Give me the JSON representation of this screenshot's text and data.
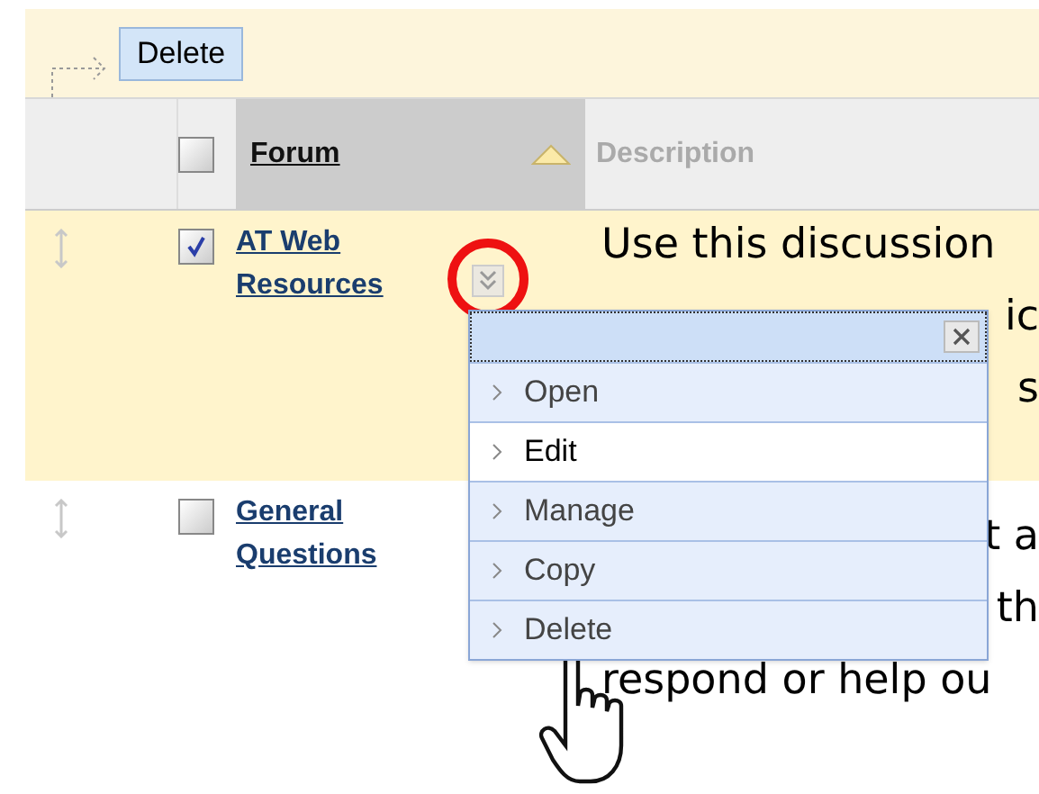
{
  "action_bar": {
    "button": "Delete"
  },
  "table": {
    "select_all": {
      "checked": false
    },
    "columns": [
      {
        "label": "Forum",
        "sorted": true
      },
      {
        "label": "Description",
        "sorted": false
      }
    ],
    "rows": [
      {
        "selected": true,
        "checked": true,
        "title": "AT Web Resources",
        "description_lines": [
          {
            "text": "Use this discussion",
            "kind": "lead"
          },
          {
            "text": "ic",
            "kind": "tail"
          },
          {
            "text": "s",
            "kind": "tail"
          }
        ]
      },
      {
        "selected": false,
        "checked": false,
        "title": "General Questions",
        "description_lines": [
          {
            "text": "t a",
            "kind": "tail"
          },
          {
            "text": "th",
            "kind": "tail"
          },
          {
            "text": "respond or help ou",
            "kind": "lead"
          }
        ]
      }
    ]
  },
  "context_menu": {
    "items": [
      {
        "label": "Open",
        "highlighted": false
      },
      {
        "label": "Edit",
        "highlighted": true
      },
      {
        "label": "Manage",
        "highlighted": false
      },
      {
        "label": "Copy",
        "highlighted": false
      },
      {
        "label": "Delete",
        "highlighted": false
      }
    ]
  }
}
